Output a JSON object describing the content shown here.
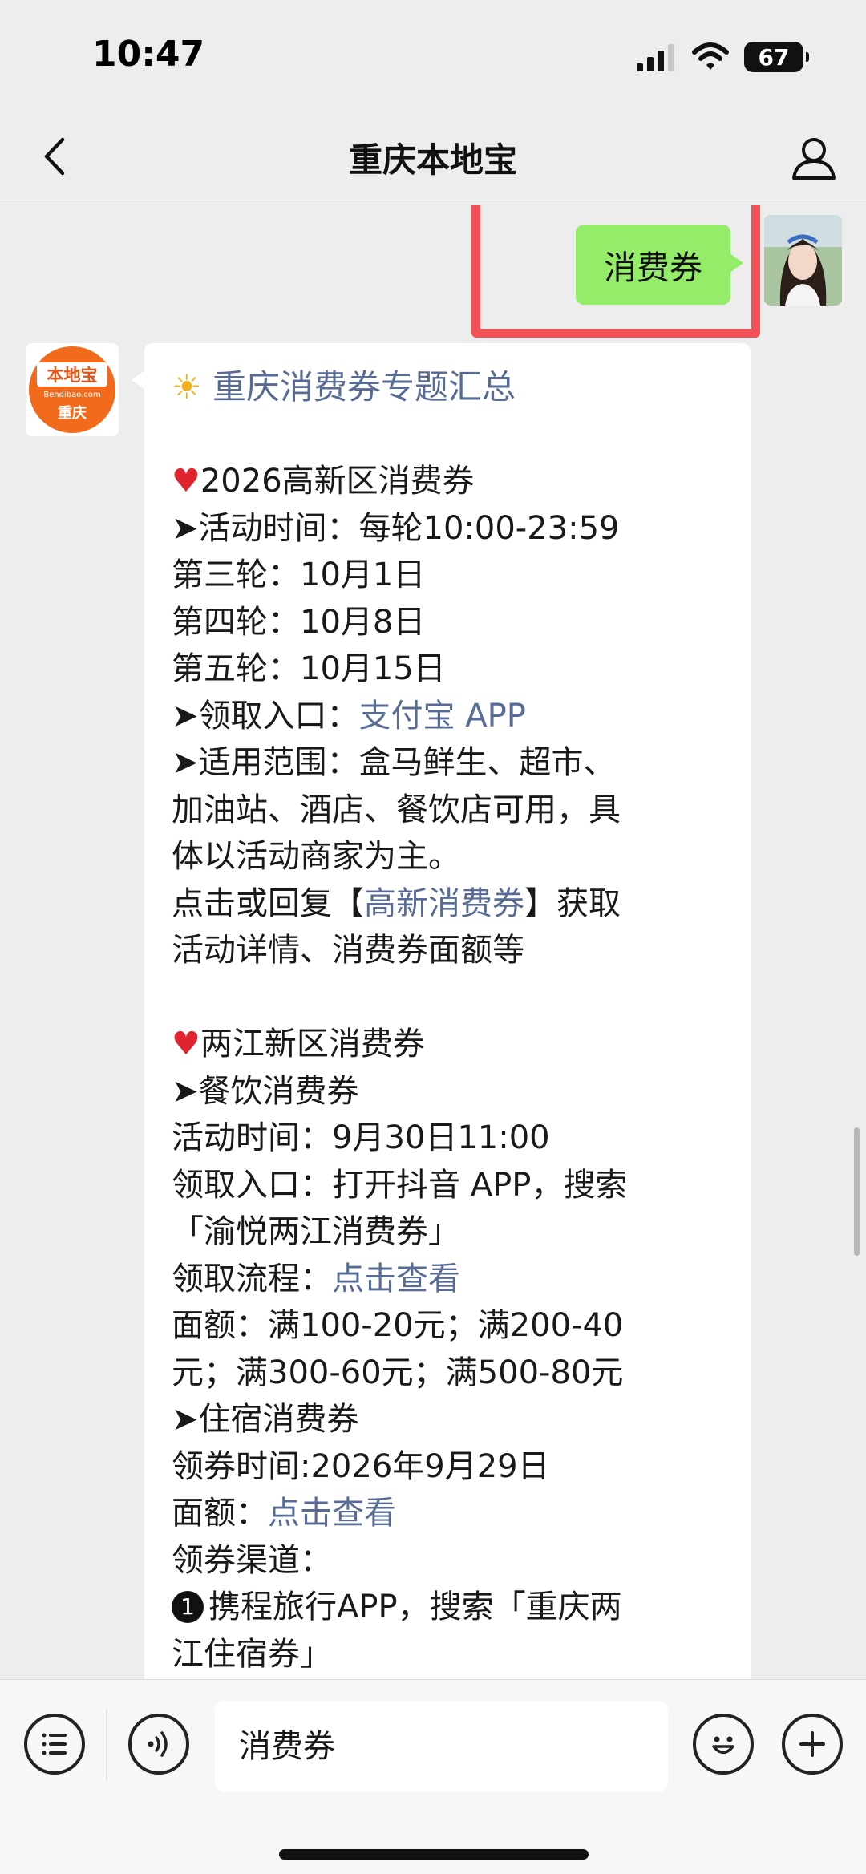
{
  "status_bar": {
    "time": "10:47",
    "battery": "67"
  },
  "nav": {
    "title": "重庆本地宝"
  },
  "sent_message": {
    "text": "消费券"
  },
  "bot": {
    "avatar_top": "本地宝",
    "avatar_site": "Bendibao.com",
    "avatar_city": "重庆"
  },
  "received_message": {
    "title": "重庆消费券专题汇总",
    "section1": {
      "heading": "2026高新区消费券",
      "time": "➤活动时间：每轮10:00-23:59",
      "round3": "第三轮：10月1日",
      "round4": "第四轮：10月8日",
      "round5": "第五轮：10月15日",
      "entry_prefix": "➤领取入口：",
      "entry_link": "支付宝 APP",
      "scope1": "➤适用范围：盒马鲜生、超市、",
      "scope2": "加油站、酒店、餐饮店可用，具",
      "scope3": "体以活动商家为主。",
      "reply_prefix": "点击或回复【",
      "reply_link": "高新消费券",
      "reply_suffix": "】获取",
      "reply_line2": "活动详情、消费券面额等"
    },
    "section2": {
      "heading": "两江新区消费券",
      "food_title": "➤餐饮消费券",
      "food_time": "活动时间：9月30日11:00",
      "food_entry1": "领取入口：打开抖音 APP，搜索",
      "food_entry2": "「渝悦两江消费券」",
      "food_process_prefix": "领取流程：",
      "food_process_link": "点击查看",
      "amount1": "面额：满100-20元；满200-40",
      "amount2": "元；满300-60元；满500-80元",
      "hotel_title": "➤住宿消费券",
      "hotel_time": "领券时间:2026年9月29日",
      "hotel_amount_prefix": "面额：",
      "hotel_amount_link": "点击查看",
      "hotel_channel": "领券渠道：",
      "channel1_num": "1",
      "channel1_line1": "携程旅行APP，搜索「重庆两",
      "channel1_line2": "江住宿券」"
    }
  },
  "input_bar": {
    "value": "消费券"
  },
  "icons": [
    "back-icon",
    "profile-icon",
    "menu-icon",
    "voice-icon",
    "emoji-icon",
    "plus-icon",
    "heart-icon",
    "sun-icon"
  ]
}
